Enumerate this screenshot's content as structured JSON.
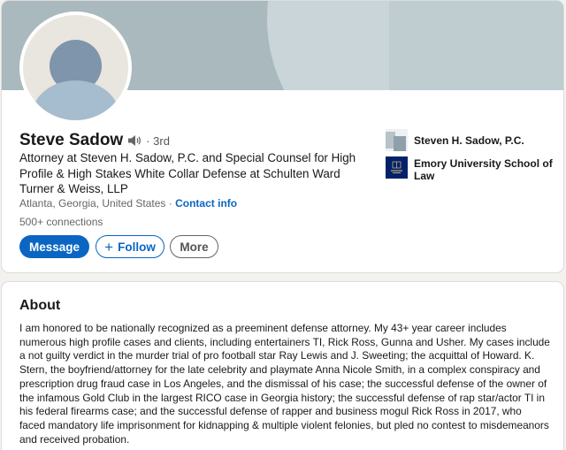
{
  "profile": {
    "name": "Steve Sadow",
    "degree": "· 3rd",
    "headline": "Attorney at Steven H. Sadow, P.C. and Special Counsel for High Profile & High Stakes White Collar Defense at Schulten Ward Turner & Weiss, LLP",
    "location": "Atlanta, Georgia, United States ·",
    "contact_info": "Contact info",
    "connections": "500+ connections"
  },
  "actions": {
    "message": "Message",
    "follow": "Follow",
    "follow_icon": "+",
    "more": "More"
  },
  "organizations": [
    {
      "name": "Steven H. Sadow, P.C.",
      "icon": "company-logo-placeholder-icon"
    },
    {
      "name": "Emory University School of Law",
      "icon": "emory-law-logo-icon"
    }
  ],
  "about": {
    "title": "About",
    "text": "I am honored to be nationally recognized as a preeminent defense attorney. My 43+ year career includes numerous high profile cases and clients, including entertainers TI, Rick Ross, Gunna and Usher. My cases include a not guilty verdict in the murder trial of pro football star Ray Lewis and J. Sweeting; the acquittal of Howard. K. Stern, the boyfriend/attorney for the late celebrity and playmate Anna Nicole Smith, in a complex conspiracy and prescription drug fraud case in Los Angeles, and the dismissal of his case; the successful defense of the owner of the infamous Gold Club in the largest RICO case in Georgia history; the successful defense of rap star/actor TI in his federal firearms case; and the successful defense of rapper and business mogul Rick Ross in 2017, who faced mandatory life imprisonment for kidnapping & multiple violent felonies, but pled no contest to misdemeanors and received probation."
  },
  "colors": {
    "accent": "#0a66c2",
    "banner": "#a9b9bd",
    "avatar_bg": "#e9e5df",
    "emory_blue": "#012169"
  }
}
